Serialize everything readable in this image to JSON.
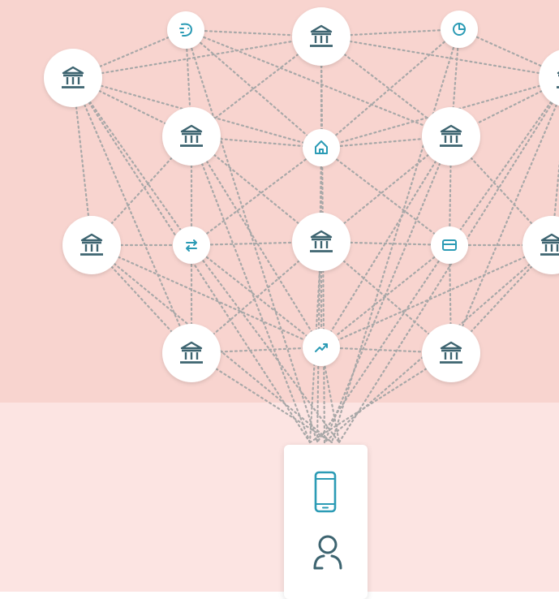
{
  "colors": {
    "background_top": "#f8d4cf",
    "background_bottom": "#fce4e2",
    "connection_line": "#a8a8a8",
    "node_fill": "#ffffff",
    "bank_icon": "#3d6470",
    "service_icon": "#2b9bb5",
    "device_icon": "#2b9bb5",
    "user_icon": "#3d6470"
  },
  "nodes": [
    {
      "name": "bank-node",
      "icon": "bank-icon"
    },
    {
      "name": "piggy-bank-node",
      "icon": "piggy-bank-icon"
    },
    {
      "name": "bank-node",
      "icon": "bank-icon"
    },
    {
      "name": "pie-chart-node",
      "icon": "pie-chart-icon"
    },
    {
      "name": "bank-node",
      "icon": "bank-icon"
    },
    {
      "name": "bank-node",
      "icon": "bank-icon"
    },
    {
      "name": "home-node",
      "icon": "home-icon"
    },
    {
      "name": "bank-node",
      "icon": "bank-icon"
    },
    {
      "name": "bank-node",
      "icon": "bank-icon"
    },
    {
      "name": "transfer-node",
      "icon": "transfer-arrows-icon"
    },
    {
      "name": "bank-node",
      "icon": "bank-icon"
    },
    {
      "name": "credit-card-node",
      "icon": "credit-card-icon"
    },
    {
      "name": "bank-node",
      "icon": "bank-icon"
    },
    {
      "name": "bank-node",
      "icon": "bank-icon"
    },
    {
      "name": "trend-node",
      "icon": "trending-up-icon"
    },
    {
      "name": "bank-node",
      "icon": "bank-icon"
    }
  ],
  "device_card": {
    "icons": [
      "smartphone-icon",
      "user-icon"
    ]
  }
}
